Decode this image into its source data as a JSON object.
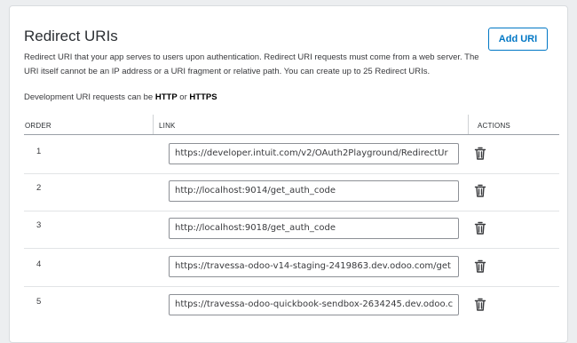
{
  "section": {
    "title": "Redirect URIs",
    "add_button": "Add URI",
    "description": "Redirect URI that your app serves to users upon authentication. Redirect URI requests must come from a web server. The URI itself cannot be an IP address or a URI fragment or relative path. You can create up to 25 Redirect URIs.",
    "dev_prefix": "Development URI requests can be ",
    "dev_http": "HTTP",
    "dev_or": " or ",
    "dev_https": "HTTPS"
  },
  "table": {
    "headers": {
      "order": "ORDER",
      "link": "LINK",
      "actions": "ACTIONS"
    },
    "rows": [
      {
        "order": "1",
        "link": "https://developer.intuit.com/v2/OAuth2Playground/RedirectUr"
      },
      {
        "order": "2",
        "link": "http://localhost:9014/get_auth_code"
      },
      {
        "order": "3",
        "link": "http://localhost:9018/get_auth_code"
      },
      {
        "order": "4",
        "link": "https://travessa-odoo-v14-staging-2419863.dev.odoo.com/get"
      },
      {
        "order": "5",
        "link": "https://travessa-odoo-quickbook-sendbox-2634245.dev.odoo.c"
      }
    ]
  },
  "icons": {
    "delete": "trash-icon"
  },
  "colors": {
    "accent": "#0077c5",
    "text": "#393a3d",
    "border": "#8d9096"
  }
}
